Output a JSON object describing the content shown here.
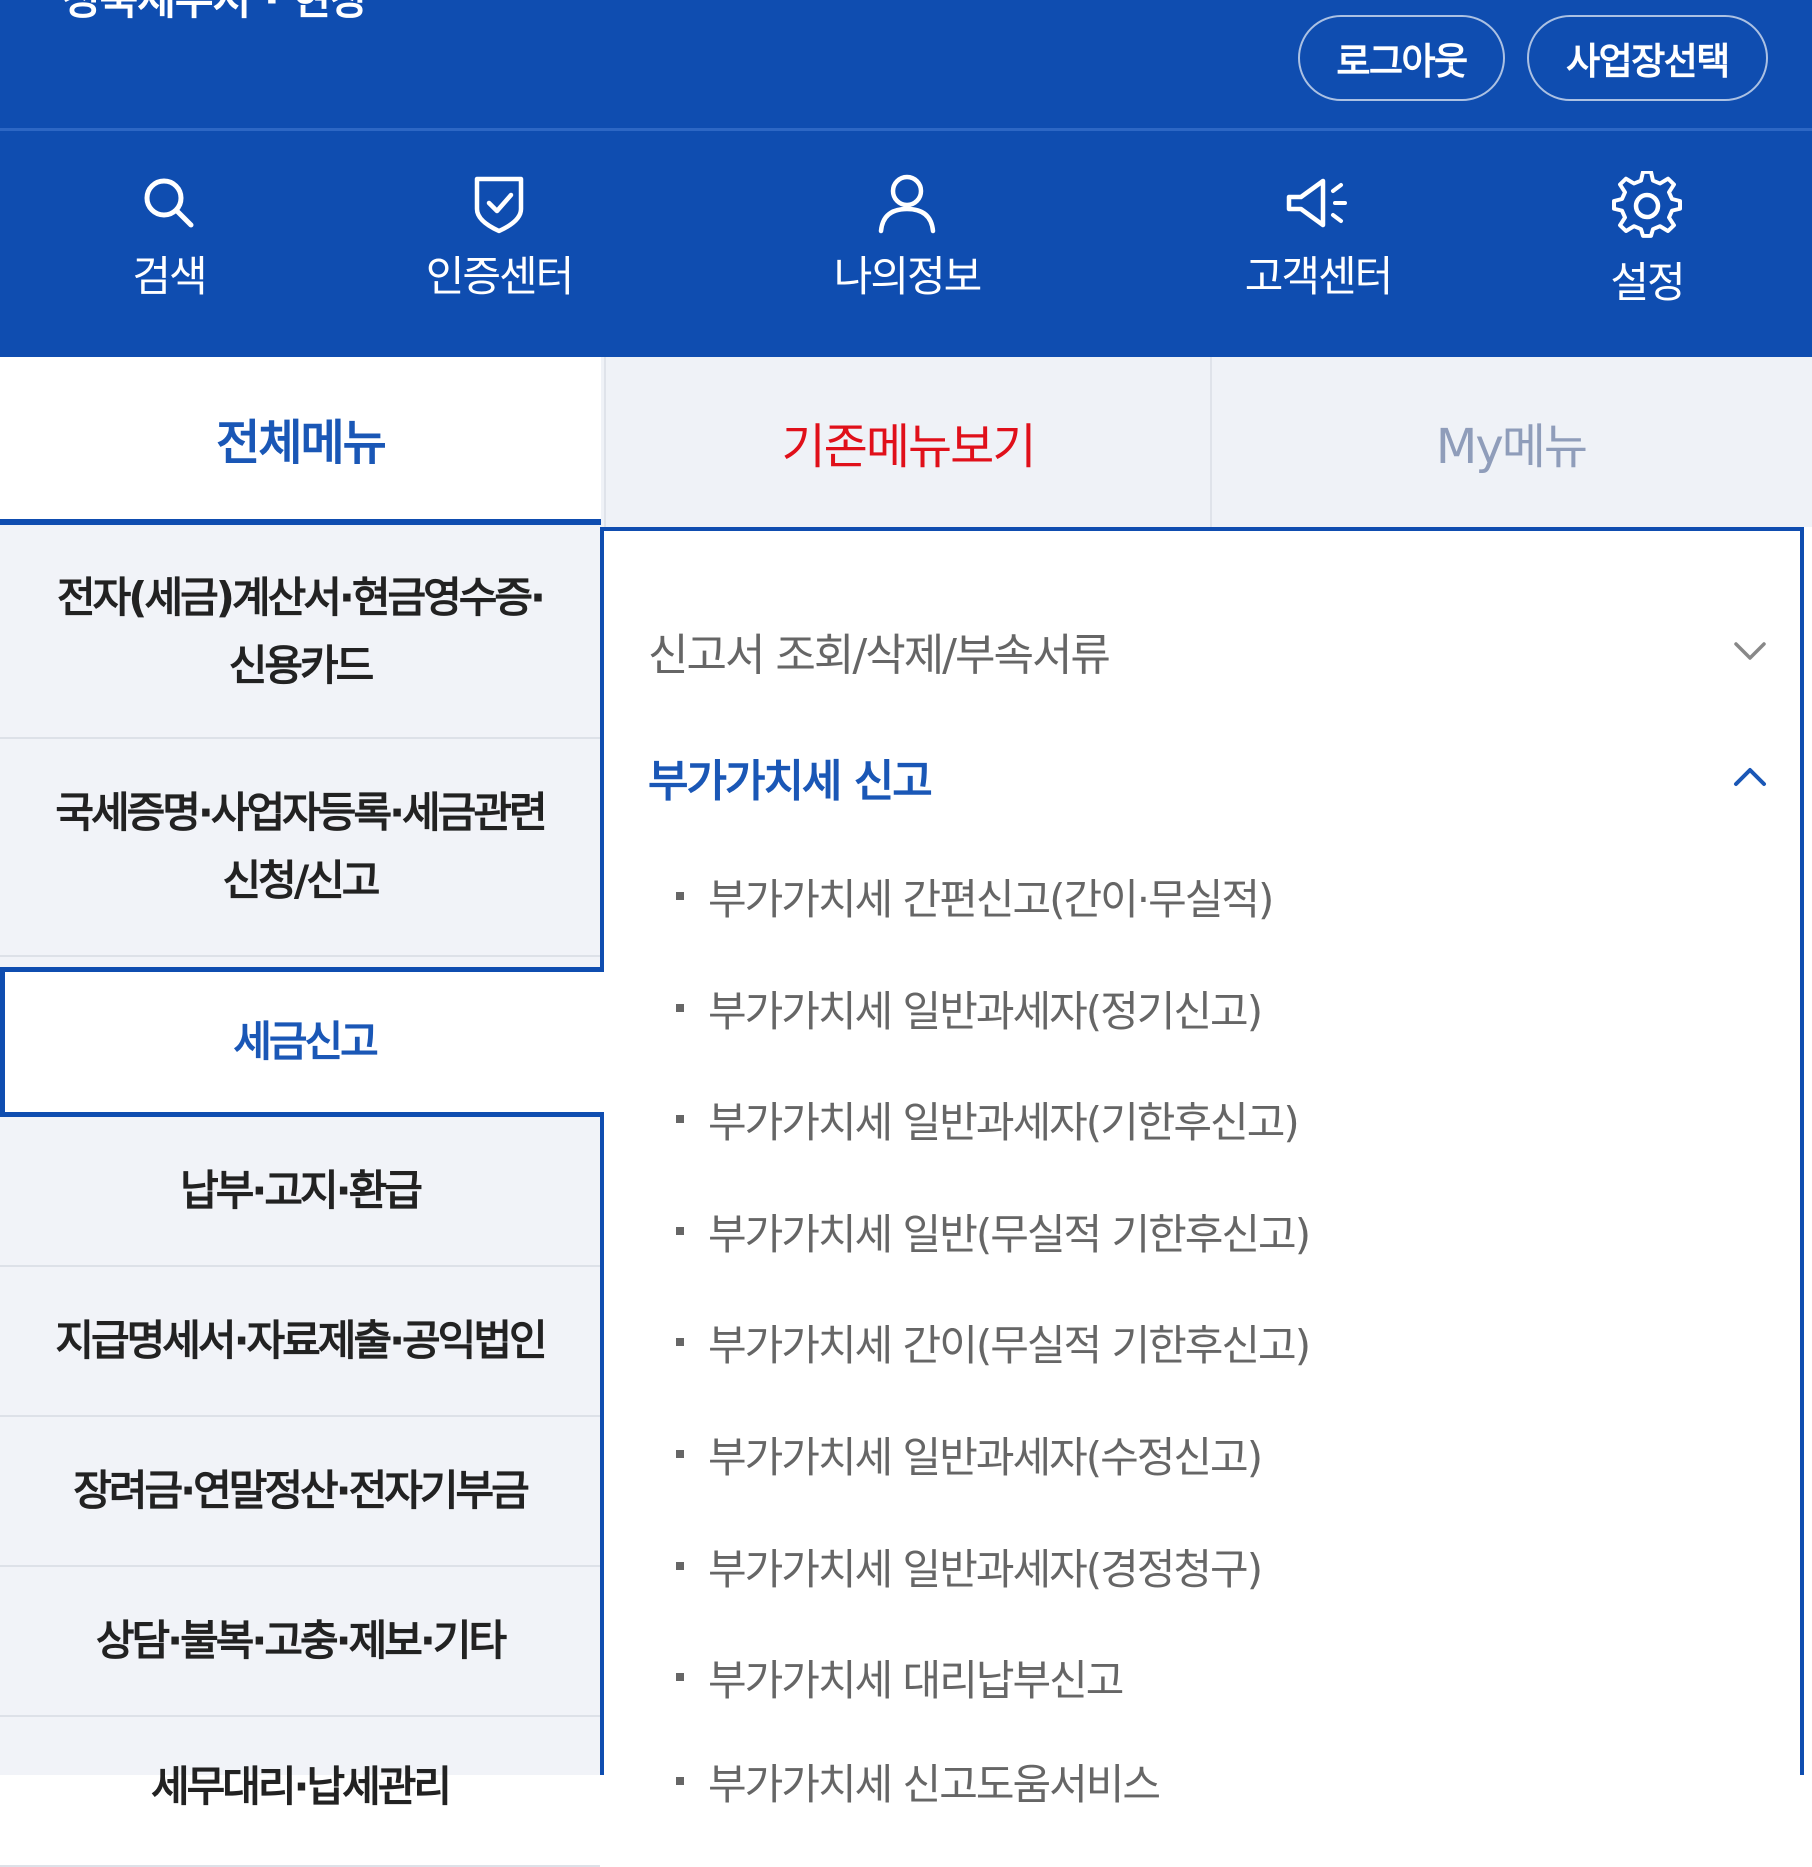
{
  "header": {
    "brand": "성북세무서 · 현장",
    "buttons": {
      "logout": "로그아웃",
      "select_business": "사업장선택"
    }
  },
  "icon_menu": [
    {
      "label": "검색",
      "icon": "search-icon"
    },
    {
      "label": "인증센터",
      "icon": "shield-check-icon"
    },
    {
      "label": "나의정보",
      "icon": "user-icon"
    },
    {
      "label": "고객센터",
      "icon": "megaphone-icon"
    },
    {
      "label": "설정",
      "icon": "gear-icon"
    }
  ],
  "tabs": {
    "all": "전체메뉴",
    "classic": "기존메뉴보기",
    "my": "My메뉴"
  },
  "categories": [
    {
      "line1": "전자(세금)계산서·현금영수증·",
      "line2": "신용카드"
    },
    {
      "line1": "국세증명·사업자등록·세금관련",
      "line2": "신청/신고"
    },
    {
      "line1": "세금신고",
      "line2": ""
    },
    {
      "line1": "납부·고지·환급",
      "line2": ""
    },
    {
      "line1": "지급명세서·자료제출·공익법인",
      "line2": ""
    },
    {
      "line1": "장려금·연말정산·전자기부금",
      "line2": ""
    },
    {
      "line1": "상담·불복·고충·제보·기타",
      "line2": ""
    },
    {
      "line1": "세무대리·납세관리",
      "line2": ""
    }
  ],
  "menu": {
    "section_closed": "신고서 조회/삭제/부속서류",
    "section_open": "부가가치세 신고",
    "items": [
      "부가가치세 간편신고(간이·무실적)",
      "부가가치세 일반과세자(정기신고)",
      "부가가치세 일반과세자(기한후신고)",
      "부가가치세 일반(무실적 기한후신고)",
      "부가가치세 간이(무실적 기한후신고)",
      "부가가치세 일반과세자(수정신고)",
      "부가가치세 일반과세자(경정청구)",
      "부가가치세 대리납부신고",
      "부가가치세 신고도움서비스"
    ]
  },
  "colors": {
    "primary": "#0f4db0",
    "accent_text": "#1a57b6",
    "classic_tab": "#e0101a",
    "my_tab": "#8f9dba"
  }
}
